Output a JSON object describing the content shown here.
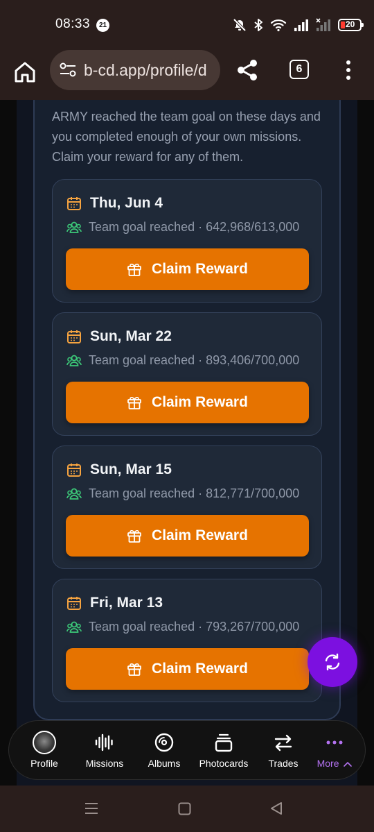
{
  "status_bar": {
    "time": "08:33",
    "notification_count": "21",
    "battery_level": "20"
  },
  "browser": {
    "url": "b-cd.app/profile/d",
    "tab_count": "6"
  },
  "rewards": {
    "intro": "ARMY reached the team goal on these days and you completed enough of your own missions. Claim your reward for any of them.",
    "cards": [
      {
        "date": "Thu, Jun 4",
        "goal_text": "Team goal reached · 642,968/613,000",
        "button_label": "Claim Reward"
      },
      {
        "date": "Sun, Mar 22",
        "goal_text": "Team goal reached · 893,406/700,000",
        "button_label": "Claim Reward"
      },
      {
        "date": "Sun, Mar 15",
        "goal_text": "Team goal reached · 812,771/700,000",
        "button_label": "Claim Reward"
      },
      {
        "date": "Fri, Mar 13",
        "goal_text": "Team goal reached · 793,267/700,000",
        "button_label": "Claim Reward"
      }
    ]
  },
  "bottom_nav": {
    "items": [
      {
        "label": "Profile",
        "icon": "avatar"
      },
      {
        "label": "Missions",
        "icon": "audio-wave-icon"
      },
      {
        "label": "Albums",
        "icon": "disc-icon"
      },
      {
        "label": "Photocards",
        "icon": "cards-stack-icon"
      },
      {
        "label": "Trades",
        "icon": "swap-arrows-icon"
      },
      {
        "label": "More",
        "icon": "more-dots-icon"
      }
    ]
  },
  "colors": {
    "accent_orange": "#e67300",
    "goal_green": "#3cc878",
    "calendar_orange": "#f5a340",
    "fab_purple": "#7c10e0",
    "more_purple": "#b372f0"
  }
}
